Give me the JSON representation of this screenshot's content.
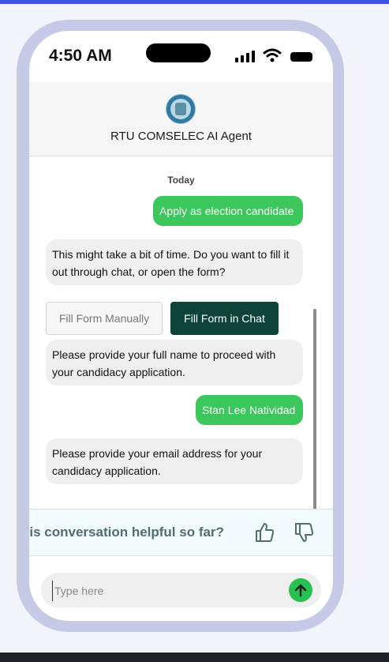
{
  "status_bar": {
    "time": "4:50 AM"
  },
  "header": {
    "agent_name": "RTU COMSELEC AI Agent",
    "logo": "comselec-seal-logo"
  },
  "chat": {
    "date_separator": "Today",
    "messages": [
      {
        "role": "user",
        "text": "Apply as election candidate"
      },
      {
        "role": "bot",
        "text": "This might take a bit of time. Do you want to fill it out through chat, or open the form?"
      },
      {
        "role": "bot",
        "text": "Please provide your full name to proceed with your candidacy application."
      },
      {
        "role": "user",
        "text": "Stan Lee Natividad"
      },
      {
        "role": "bot",
        "text": "Please provide your email address for your candidacy application."
      }
    ],
    "options": {
      "fill_manually": "Fill Form Manually",
      "fill_in_chat": "Fill Form in Chat"
    }
  },
  "feedback": {
    "question": "his conversation helpful so far?",
    "thumbs_up_icon": "thumbs-up-icon",
    "thumbs_down_icon": "thumbs-down-icon"
  },
  "composer": {
    "placeholder": "Type here",
    "value": "",
    "send_icon": "arrow-up-icon"
  },
  "colors": {
    "user_bubble": "#3cc75d",
    "bot_bubble": "#efefef",
    "primary_button": "#0e433a",
    "send_button": "#27c14f",
    "phone_frame": "#c6cae6",
    "top_accent": "#3b54e6"
  }
}
